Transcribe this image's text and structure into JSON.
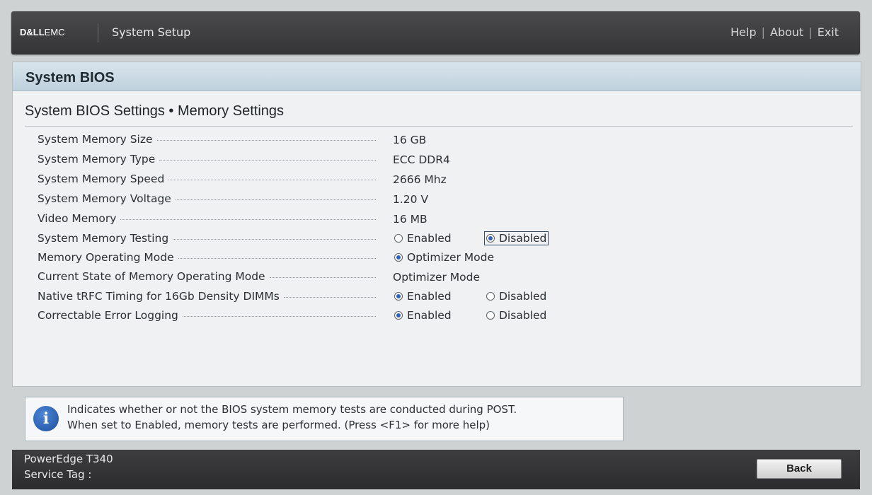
{
  "brand": {
    "dell": "D&LL",
    "emc": "EMC"
  },
  "app_title": "System Setup",
  "top_nav": {
    "help": "Help",
    "about": "About",
    "exit": "Exit",
    "separator": "|"
  },
  "panel_title": "System BIOS",
  "section_title": "System BIOS Settings • Memory Settings",
  "settings": [
    {
      "label": "System Memory Size",
      "value": "16 GB"
    },
    {
      "label": "System Memory Type",
      "value": "ECC DDR4"
    },
    {
      "label": "System Memory Speed",
      "value": "2666 Mhz"
    },
    {
      "label": "System Memory Voltage",
      "value": "1.20 V"
    },
    {
      "label": "Video Memory",
      "value": "16 MB"
    },
    {
      "label": "System Memory Testing",
      "options": [
        "Enabled",
        "Disabled"
      ],
      "selected": "Disabled"
    },
    {
      "label": "Memory Operating Mode",
      "options": [
        "Optimizer Mode"
      ],
      "selected": "Optimizer Mode"
    },
    {
      "label": "Current State of Memory Operating Mode",
      "value": "Optimizer Mode"
    },
    {
      "label": "Native tRFC Timing for 16Gb Density DIMMs",
      "options": [
        "Enabled",
        "Disabled"
      ],
      "selected": "Enabled"
    },
    {
      "label": "Correctable Error Logging",
      "options": [
        "Enabled",
        "Disabled"
      ],
      "selected": "Enabled"
    }
  ],
  "help": {
    "icon": "info-icon",
    "line1": "Indicates whether or not the BIOS system memory tests are conducted during POST.",
    "line2": "When set to Enabled, memory tests are performed. (Press <F1> for more help)"
  },
  "footer": {
    "model": "PowerEdge T340",
    "service_tag": "Service Tag :",
    "back_label": "Back"
  },
  "colors": {
    "accent": "#2d62b8",
    "header_bg": "#3d3d3f",
    "panel_header": "#c9d9e4"
  }
}
